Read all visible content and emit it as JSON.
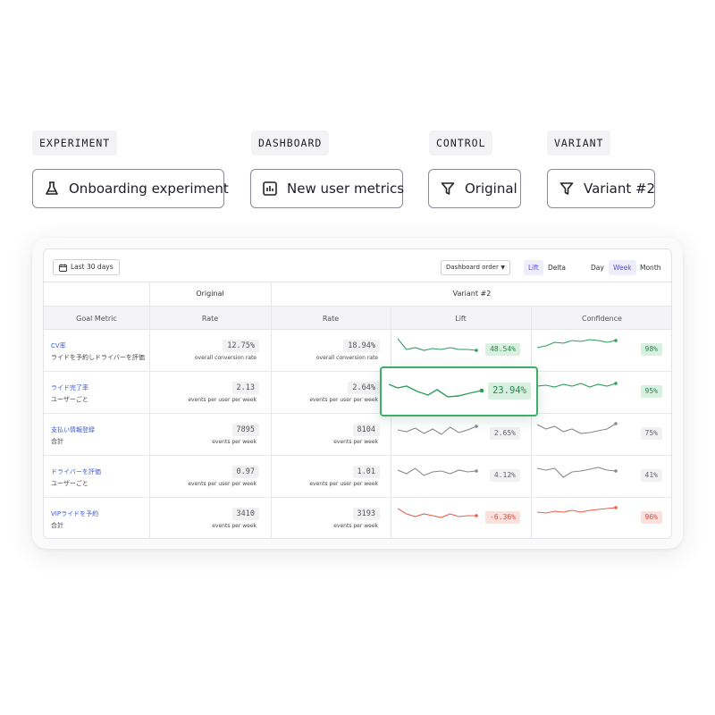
{
  "selectors": {
    "experiment": {
      "label": "EXPERIMENT",
      "value": "Onboarding experiment",
      "icon": "flask-icon"
    },
    "dashboard": {
      "label": "DASHBOARD",
      "value": "New user metrics",
      "icon": "chart-icon"
    },
    "control": {
      "label": "CONTROL",
      "value": "Original",
      "icon": "filter-icon"
    },
    "variant": {
      "label": "VARIANT",
      "value": "Variant #2",
      "icon": "filter-icon"
    }
  },
  "toolbar": {
    "date_range": "Last 30 days",
    "order": "Dashboard order",
    "mode": [
      "Lift",
      "Delta"
    ],
    "mode_active": "Lift",
    "granularity": [
      "Day",
      "Week",
      "Month"
    ],
    "granularity_active": "Week"
  },
  "table": {
    "group_headers": {
      "control": "Original",
      "variant": "Variant #2"
    },
    "columns": [
      "Goal Metric",
      "Rate",
      "Rate",
      "Lift",
      "Confidence"
    ],
    "rows": [
      {
        "name": "CV率",
        "sub": "ライドを予約しドライバーを評価",
        "control_rate": "12.75%",
        "control_unit": "overall conversion rate",
        "variant_rate": "18.94%",
        "variant_unit": "overall conversion rate",
        "lift": "48.54%",
        "confidence": "98%",
        "tone": "positive"
      },
      {
        "name": "ライド完了率",
        "sub": "ユーザーごと",
        "control_rate": "2.13",
        "control_unit": "events per user per week",
        "variant_rate": "2.64%",
        "variant_unit": "events per user per week",
        "lift": "23.94%",
        "confidence": "95%",
        "tone": "positive"
      },
      {
        "name": "支払い情報登録",
        "sub": "合計",
        "control_rate": "7895",
        "control_unit": "events per week",
        "variant_rate": "8104",
        "variant_unit": "events per week",
        "lift": "2.65%",
        "confidence": "75%",
        "tone": "neutral"
      },
      {
        "name": "ドライバーを評価",
        "sub": "ユーザーごと",
        "control_rate": "0.97",
        "control_unit": "events per user per week",
        "variant_rate": "1.01",
        "variant_unit": "events per user per week",
        "lift": "4.12%",
        "confidence": "41%",
        "tone": "neutral"
      },
      {
        "name": "VIPライドを予約",
        "sub": "合計",
        "control_rate": "3410",
        "control_unit": "events per week",
        "variant_rate": "3193",
        "variant_unit": "events per week",
        "lift": "-6.36%",
        "confidence": "96%",
        "tone": "negative"
      }
    ]
  },
  "colors": {
    "positive": "#2e9e5b",
    "neutral": "#888891",
    "negative": "#e8604c",
    "accent": "#5b4fd9"
  }
}
